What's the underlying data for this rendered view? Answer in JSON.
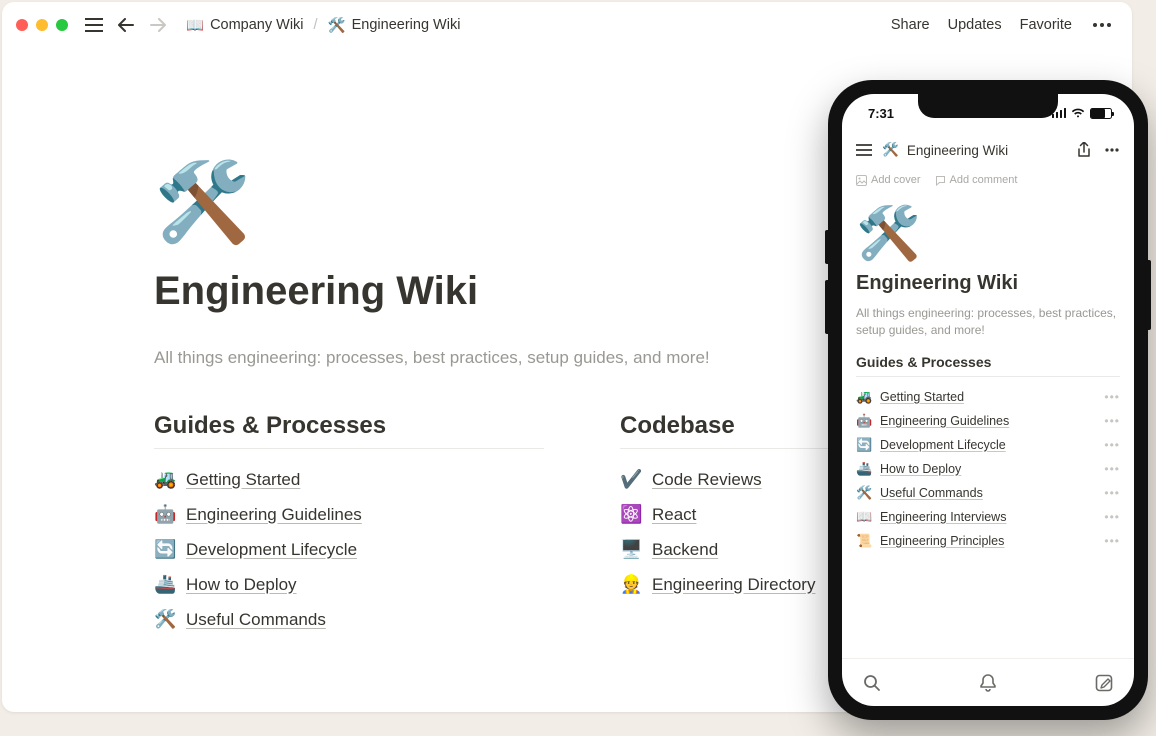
{
  "titlebar": {
    "breadcrumb": [
      {
        "icon": "📖",
        "label": "Company Wiki"
      },
      {
        "icon": "🛠️",
        "label": "Engineering Wiki"
      }
    ],
    "sep": "/",
    "actions": {
      "share": "Share",
      "updates": "Updates",
      "favorite": "Favorite"
    }
  },
  "page": {
    "icon": "🛠️",
    "title": "Engineering Wiki",
    "description": "All things engineering: processes, best practices, setup guides, and more!",
    "sections": [
      {
        "heading": "Guides & Processes",
        "items": [
          {
            "icon": "🚜",
            "label": "Getting Started"
          },
          {
            "icon": "🤖",
            "label": "Engineering Guidelines"
          },
          {
            "icon": "🔄",
            "label": "Development Lifecycle"
          },
          {
            "icon": "🚢",
            "label": "How to Deploy"
          },
          {
            "icon": "🛠️",
            "label": "Useful Commands"
          }
        ]
      },
      {
        "heading": "Codebase",
        "items": [
          {
            "icon": "✔️",
            "label": "Code Reviews"
          },
          {
            "icon": "⚛️",
            "label": "React"
          },
          {
            "icon": "🖥️",
            "label": "Backend"
          },
          {
            "icon": "👷",
            "label": "Engineering Directory"
          }
        ]
      }
    ]
  },
  "mobile": {
    "time": "7:31",
    "topbar": {
      "icon": "🛠️",
      "title": "Engineering Wiki"
    },
    "hints": {
      "cover": "Add cover",
      "comment": "Add comment"
    },
    "page": {
      "icon": "🛠️",
      "title": "Engineering Wiki",
      "description": "All things engineering: processes, best practices, setup guides, and more!",
      "heading": "Guides & Processes",
      "items": [
        {
          "icon": "🚜",
          "label": "Getting Started"
        },
        {
          "icon": "🤖",
          "label": "Engineering Guidelines"
        },
        {
          "icon": "🔄",
          "label": "Development Lifecycle"
        },
        {
          "icon": "🚢",
          "label": "How to Deploy"
        },
        {
          "icon": "🛠️",
          "label": "Useful Commands"
        },
        {
          "icon": "📖",
          "label": "Engineering Interviews"
        },
        {
          "icon": "📜",
          "label": "Engineering Principles"
        }
      ]
    }
  }
}
